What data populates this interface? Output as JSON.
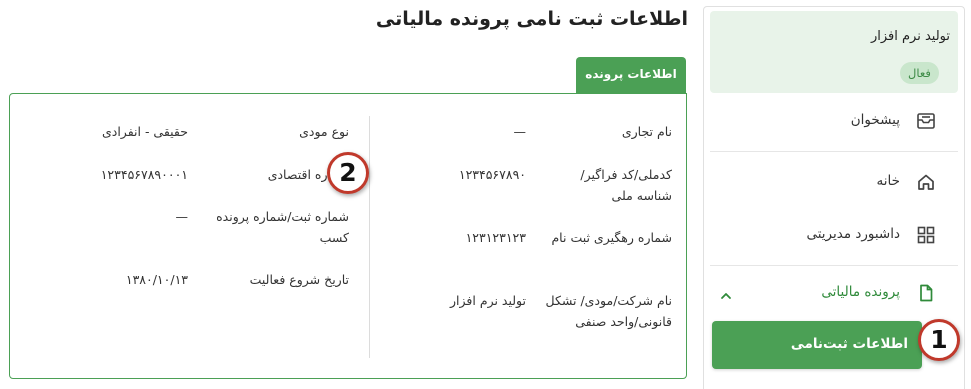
{
  "sidebar": {
    "company": {
      "name": "تولید نرم افزار",
      "status": "فعال"
    },
    "items": [
      {
        "label": "پیشخوان",
        "icon": "inbox-tray-icon"
      },
      {
        "label": "خانه",
        "icon": "home-icon"
      },
      {
        "label": "داشبورد مدیریتی",
        "icon": "dashboard-grid-icon"
      },
      {
        "label": "پرونده مالیاتی",
        "icon": "document-icon",
        "expanded": true
      }
    ],
    "sub_item": {
      "label": "اطلاعات ثبت‌نامی"
    }
  },
  "main": {
    "title": "اطلاعات ثبت نامی پرونده مالیاتی",
    "tab": "اطلاعات پرونده",
    "right_column": [
      {
        "label": "نام تجاری",
        "value": "—"
      },
      {
        "label": "کدملی/کد فراگیر/ شناسه ملی",
        "value": "۱۲۳۴۵۶۷۸۹۰"
      },
      {
        "label": "شماره رهگیری ثبت نام",
        "value": "۱۲۳۱۲۳۱۲۳"
      },
      {
        "label": "نام شرکت/مودی/ تشکل قانونی/واحد صنفی",
        "value": "تولید نرم افزار"
      }
    ],
    "left_column": [
      {
        "label": "نوع مودی",
        "value": "حقیقی - انفرادی"
      },
      {
        "label": "شماره اقتصادی",
        "value": "۱۲۳۴۵۶۷۸۹۰۰۰۱"
      },
      {
        "label": "شماره ثبت/شماره پرونده کسب",
        "value": "—"
      },
      {
        "label": "تاریخ شروع فعالیت",
        "value": "۱۳۸۰/۱۰/۱۳"
      }
    ]
  },
  "markers": [
    "1",
    "2"
  ],
  "colors": {
    "accent": "#4ba055",
    "accent_light": "#e8f3e9",
    "marker_border": "#c0392b"
  }
}
